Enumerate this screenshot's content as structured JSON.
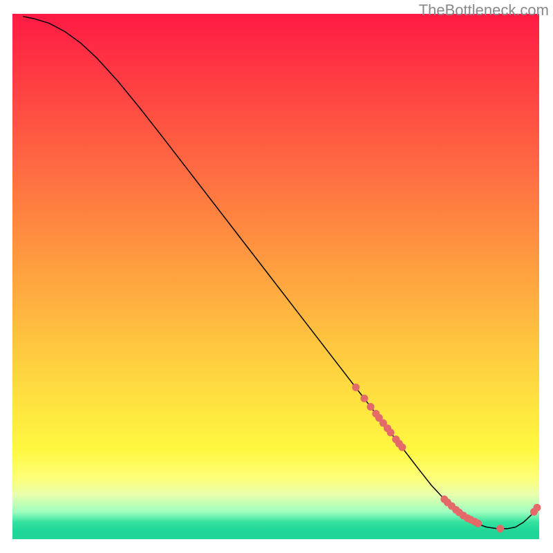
{
  "watermark": "TheBottleneck.com",
  "chart_data": {
    "type": "line",
    "title": "",
    "xlabel": "",
    "ylabel": "",
    "xlim": [
      0,
      100
    ],
    "ylim": [
      0,
      100
    ],
    "background_gradient": {
      "stops": [
        {
          "offset": 0.0,
          "color": "#ff1a44"
        },
        {
          "offset": 0.5,
          "color": "#ffa340"
        },
        {
          "offset": 0.72,
          "color": "#ffde40"
        },
        {
          "offset": 0.83,
          "color": "#fff840"
        },
        {
          "offset": 0.885,
          "color": "#fdff7a"
        },
        {
          "offset": 0.915,
          "color": "#e9ffad"
        },
        {
          "offset": 0.948,
          "color": "#9effc0"
        },
        {
          "offset": 0.968,
          "color": "#33e29f"
        },
        {
          "offset": 0.985,
          "color": "#1fd597"
        },
        {
          "offset": 1.0,
          "color": "#1fd597"
        }
      ]
    },
    "series": [
      {
        "name": "curve",
        "type": "line",
        "color": "#000000",
        "width": 1.5,
        "x": [
          2,
          4,
          7,
          10,
          13,
          16,
          20,
          24,
          28,
          32,
          36,
          40,
          44,
          48,
          52,
          56,
          60,
          64,
          68,
          71,
          74,
          77,
          79.5,
          82,
          84,
          86,
          88,
          90,
          92,
          94,
          95.5,
          97,
          98.5,
          99.5
        ],
        "y": [
          99.5,
          99.1,
          98.2,
          96.6,
          94.4,
          91.6,
          87.2,
          82.3,
          77.2,
          72.0,
          66.8,
          61.6,
          56.4,
          51.2,
          46.0,
          40.8,
          35.6,
          30.4,
          25.2,
          21.3,
          17.4,
          13.5,
          10.3,
          7.6,
          5.6,
          4.1,
          3.0,
          2.3,
          2.0,
          2.0,
          2.3,
          3.2,
          4.6,
          5.8
        ]
      },
      {
        "name": "markers",
        "type": "scatter",
        "color": "#e46a6a",
        "radius": 5.5,
        "x": [
          65.2,
          66.8,
          68.0,
          69.0,
          69.6,
          70.4,
          71.2,
          71.8,
          72.8,
          73.4,
          74.0,
          82.0,
          82.6,
          83.4,
          84.2,
          84.8,
          85.6,
          86.4,
          87.0,
          87.8,
          88.4,
          92.6,
          99.0,
          99.6
        ],
        "y": [
          28.9,
          26.8,
          25.2,
          23.9,
          23.1,
          22.1,
          21.1,
          20.3,
          19.0,
          18.2,
          17.5,
          7.6,
          7.0,
          6.3,
          5.6,
          5.1,
          4.5,
          4.0,
          3.7,
          3.3,
          3.0,
          2.0,
          5.2,
          6.0
        ]
      }
    ]
  }
}
